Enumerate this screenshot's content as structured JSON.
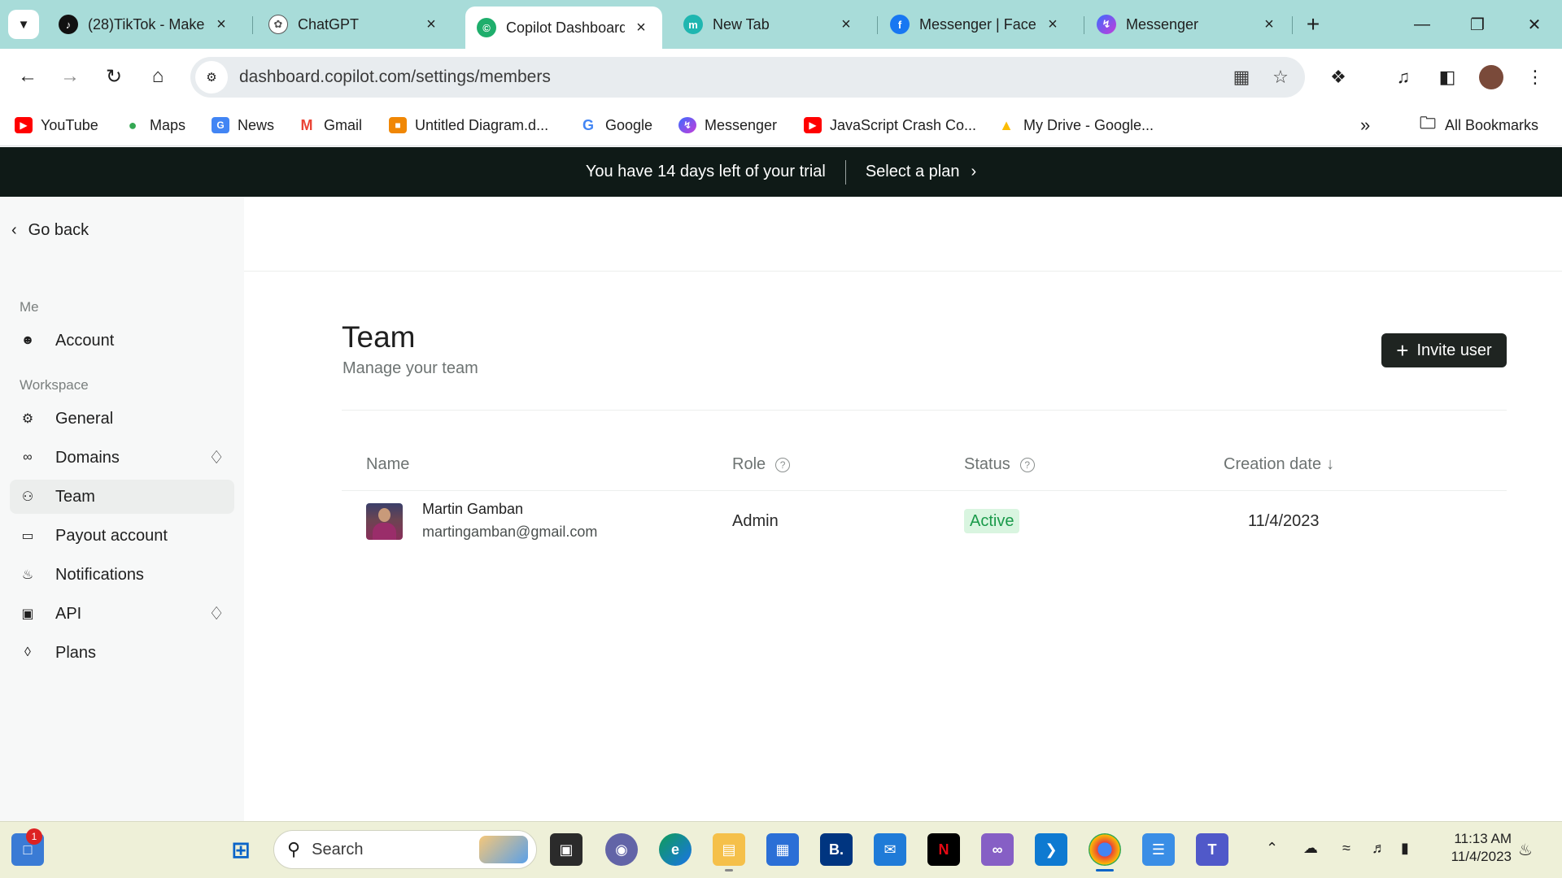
{
  "browser": {
    "tabs": [
      {
        "title": "(28)TikTok - Make",
        "active": false
      },
      {
        "title": "ChatGPT",
        "active": false
      },
      {
        "title": "Copilot Dashboard",
        "active": true
      },
      {
        "title": "New Tab",
        "active": false
      },
      {
        "title": "Messenger | Faceb",
        "active": false
      },
      {
        "title": "Messenger",
        "active": false
      }
    ],
    "url": "dashboard.copilot.com/settings/members",
    "bookmarks": [
      "YouTube",
      "Maps",
      "News",
      "Gmail",
      "Untitled Diagram.d...",
      "Google",
      "Messenger",
      "JavaScript Crash Co...",
      "My Drive - Google...",
      "All Bookmarks"
    ]
  },
  "banner": {
    "trial_text": "You have 14 days left of your trial",
    "plan_link": "Select a plan"
  },
  "sidebar": {
    "go_back": "Go back",
    "section_me": "Me",
    "section_workspace": "Workspace",
    "items": [
      {
        "label": "Account",
        "icon": "user-circle-icon",
        "premium": false,
        "active": false
      },
      {
        "label": "General",
        "icon": "gear-icon",
        "premium": false,
        "active": false
      },
      {
        "label": "Domains",
        "icon": "link-icon",
        "premium": true,
        "active": false
      },
      {
        "label": "Team",
        "icon": "users-icon",
        "premium": false,
        "active": true
      },
      {
        "label": "Payout account",
        "icon": "credit-card-icon",
        "premium": false,
        "active": false
      },
      {
        "label": "Notifications",
        "icon": "bell-icon",
        "premium": false,
        "active": false
      },
      {
        "label": "API",
        "icon": "chip-icon",
        "premium": true,
        "active": false
      },
      {
        "label": "Plans",
        "icon": "tag-icon",
        "premium": false,
        "active": false
      }
    ]
  },
  "main": {
    "title": "Team",
    "subtitle": "Manage your team",
    "invite_button": "Invite user",
    "table": {
      "headers": {
        "name": "Name",
        "role": "Role",
        "status": "Status",
        "created": "Creation date"
      },
      "rows": [
        {
          "name": "Martin Gamban",
          "email": "martingamban@gmail.com",
          "role": "Admin",
          "status": "Active",
          "created": "11/4/2023"
        }
      ]
    }
  },
  "taskbar": {
    "search_placeholder": "Search",
    "widgets_badge": "1",
    "time": "11:13 AM",
    "date": "11/4/2023"
  },
  "colors": {
    "tabstrip": "#a8dcd9",
    "banner_bg": "#0f1a17",
    "button_dark": "#1f2421",
    "status_active_bg": "#d9f5e0",
    "status_active_text": "#1a9a4a",
    "taskbar_bg": "#eef0d8"
  }
}
